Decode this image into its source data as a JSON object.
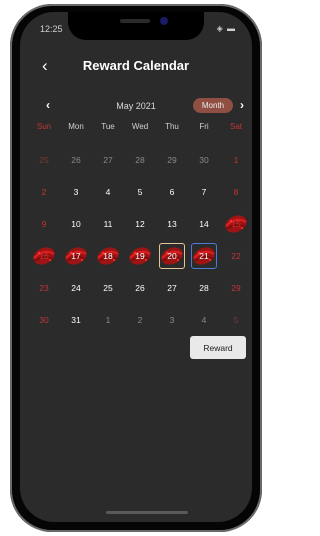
{
  "status": {
    "time": "12:25",
    "icons": "◈ ▬"
  },
  "header": {
    "back_icon": "‹",
    "title": "Reward Calendar"
  },
  "month_nav": {
    "prev_icon": "‹",
    "next_icon": "›",
    "label": "May 2021",
    "view_toggle": "Month"
  },
  "weekdays": [
    "Sun",
    "Mon",
    "Tue",
    "Wed",
    "Thu",
    "Fri",
    "Sat"
  ],
  "weeks": [
    [
      "25",
      "26",
      "27",
      "28",
      "29",
      "30",
      "1"
    ],
    [
      "2",
      "3",
      "4",
      "5",
      "6",
      "7",
      "8"
    ],
    [
      "9",
      "10",
      "11",
      "12",
      "13",
      "14",
      "15"
    ],
    [
      "16",
      "17",
      "18",
      "19",
      "20",
      "21",
      "22"
    ],
    [
      "23",
      "24",
      "25",
      "26",
      "27",
      "28",
      "29"
    ],
    [
      "30",
      "31",
      "1",
      "2",
      "3",
      "4",
      "5"
    ]
  ],
  "reward_button": "Reward",
  "colors": {
    "background": "#2b2b2b",
    "weekend": "#c23535",
    "month_pill": "#8f4f43",
    "stamp": "#b01010",
    "selected_border": "#e3c59a",
    "today_border": "#4a7cd6"
  }
}
